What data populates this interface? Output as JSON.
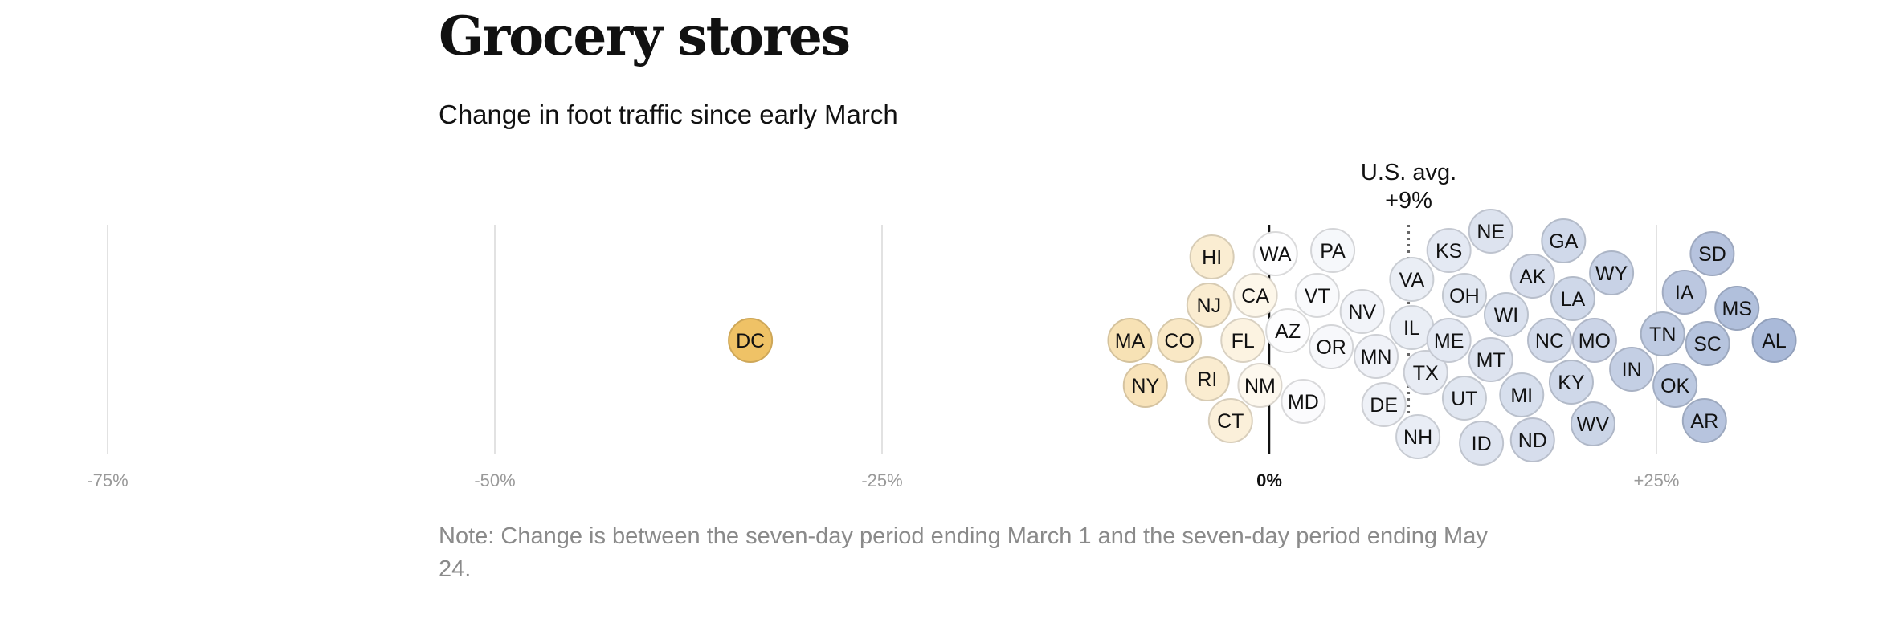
{
  "header": {
    "title": "Grocery stores",
    "subtitle": "Change in foot traffic since early March"
  },
  "note": "Note: Change is between the seven-day period ending March 1 and the seven-day period ending May 24.",
  "chart_data": {
    "type": "scatter",
    "title": "Grocery stores",
    "subtitle": "Change in foot traffic since early March",
    "xlabel": "",
    "ylabel": "",
    "x_unit": "percent change",
    "xlim": [
      -75,
      30
    ],
    "x_ticks": [
      {
        "value": -75,
        "label": "-75%",
        "bold": false
      },
      {
        "value": -50,
        "label": "-50%",
        "bold": false
      },
      {
        "value": -25,
        "label": "-25%",
        "bold": false
      },
      {
        "value": 0,
        "label": "0%",
        "bold": true
      },
      {
        "value": 25,
        "label": "+25%",
        "bold": false
      }
    ],
    "grid": true,
    "reference_line": {
      "value": 9,
      "label_line1": "U.S. avg.",
      "label_line2": "+9%"
    },
    "color_scale": {
      "low": "#efc265",
      "mid": "#ffffff",
      "high": "#a9b9d8"
    },
    "points": [
      {
        "state": "DC",
        "x": -33.5
      },
      {
        "state": "MA",
        "x": -9.0
      },
      {
        "state": "NY",
        "x": -8.0
      },
      {
        "state": "RI",
        "x": -4.0
      },
      {
        "state": "NJ",
        "x": -3.9
      },
      {
        "state": "CO",
        "x": -5.8
      },
      {
        "state": "HI",
        "x": -3.7
      },
      {
        "state": "CT",
        "x": -2.5
      },
      {
        "state": "FL",
        "x": -1.7
      },
      {
        "state": "CA",
        "x": -0.9
      },
      {
        "state": "NM",
        "x": -0.6
      },
      {
        "state": "WA",
        "x": 0.4
      },
      {
        "state": "AZ",
        "x": 1.2
      },
      {
        "state": "MD",
        "x": 2.2
      },
      {
        "state": "VT",
        "x": 3.1
      },
      {
        "state": "OR",
        "x": 4.0
      },
      {
        "state": "PA",
        "x": 4.1
      },
      {
        "state": "NV",
        "x": 6.0
      },
      {
        "state": "MN",
        "x": 6.9
      },
      {
        "state": "DE",
        "x": 7.4
      },
      {
        "state": "NH",
        "x": 9.6
      },
      {
        "state": "IL",
        "x": 9.2
      },
      {
        "state": "VA",
        "x": 9.2
      },
      {
        "state": "TX",
        "x": 10.1
      },
      {
        "state": "KS",
        "x": 11.6
      },
      {
        "state": "ME",
        "x": 11.6
      },
      {
        "state": "OH",
        "x": 12.6
      },
      {
        "state": "UT",
        "x": 12.6
      },
      {
        "state": "ID",
        "x": 13.7
      },
      {
        "state": "MT",
        "x": 14.3
      },
      {
        "state": "NE",
        "x": 14.3
      },
      {
        "state": "WI",
        "x": 15.3
      },
      {
        "state": "MI",
        "x": 16.3
      },
      {
        "state": "AK",
        "x": 17.0
      },
      {
        "state": "ND",
        "x": 17.0
      },
      {
        "state": "NC",
        "x": 18.1
      },
      {
        "state": "KY",
        "x": 19.5
      },
      {
        "state": "LA",
        "x": 19.6
      },
      {
        "state": "GA",
        "x": 19.0
      },
      {
        "state": "WV",
        "x": 20.9
      },
      {
        "state": "WY",
        "x": 22.1
      },
      {
        "state": "MO",
        "x": 21.0
      },
      {
        "state": "IN",
        "x": 23.4
      },
      {
        "state": "TN",
        "x": 25.4
      },
      {
        "state": "OK",
        "x": 26.2
      },
      {
        "state": "IA",
        "x": 26.8
      },
      {
        "state": "AR",
        "x": 28.1
      },
      {
        "state": "SC",
        "x": 28.3
      },
      {
        "state": "SD",
        "x": 28.6
      },
      {
        "state": "MS",
        "x": 30.2
      },
      {
        "state": "AL",
        "x": 32.6
      }
    ]
  }
}
